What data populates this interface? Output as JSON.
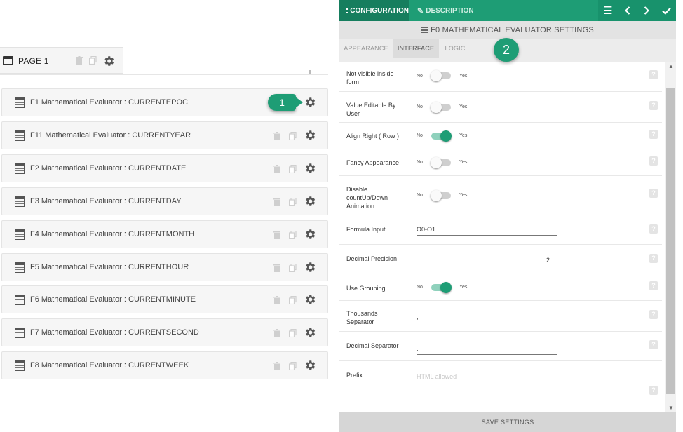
{
  "page_tab": {
    "label": "PAGE 1"
  },
  "fields": [
    {
      "label": "F1 Mathematical Evaluator : CURRENTEPOC"
    },
    {
      "label": "F11 Mathematical Evaluator : CURRENTYEAR"
    },
    {
      "label": "F2 Mathematical Evaluator : CURRENTDATE"
    },
    {
      "label": "F3 Mathematical Evaluator : CURRENTDAY"
    },
    {
      "label": "F4 Mathematical Evaluator : CURRENTMONTH"
    },
    {
      "label": "F5 Mathematical Evaluator : CURRENTHOUR"
    },
    {
      "label": "F6 Mathematical Evaluator : CURRENTMINUTE"
    },
    {
      "label": "F7 Mathematical Evaluator : CURRENTSECOND"
    },
    {
      "label": "F8 Mathematical Evaluator : CURRENTWEEK"
    }
  ],
  "callouts": {
    "one": "1",
    "two": "2"
  },
  "panel": {
    "tab_configuration": "CONFIGURATION",
    "tab_description": "DESCRIPTION",
    "title": "F0 MATHEMATICAL EVALUATOR SETTINGS",
    "subtabs": {
      "appearance": "APPEARANCE",
      "interface": "INTERFACE",
      "logic": "LOGIC"
    },
    "toggle_no": "No",
    "toggle_yes": "Yes",
    "help_glyph": "?",
    "settings": {
      "not_visible": {
        "label": "Not visible inside form",
        "on": false
      },
      "value_editable": {
        "label": "Value Editable By User",
        "on": false
      },
      "align_right": {
        "label": "Align Right ( Row )",
        "on": true
      },
      "fancy_appearance": {
        "label": "Fancy Appearance",
        "on": false
      },
      "disable_countup": {
        "label": "Disable countUp/Down Animation",
        "on": false
      },
      "formula_input": {
        "label": "Formula Input",
        "value": "O0-O1"
      },
      "decimal_precision": {
        "label": "Decimal Precision",
        "value": "2"
      },
      "use_grouping": {
        "label": "Use Grouping",
        "on": true
      },
      "thousands_separator": {
        "label": "Thousands Separator",
        "value": ","
      },
      "decimal_separator": {
        "label": "Decimal Separator",
        "value": "."
      },
      "prefix": {
        "label": "Prefix",
        "placeholder": "HTML allowed"
      }
    },
    "save_button": "SAVE SETTINGS"
  },
  "colors": {
    "accent": "#1e9d75",
    "accent_dark": "#167e5e"
  }
}
